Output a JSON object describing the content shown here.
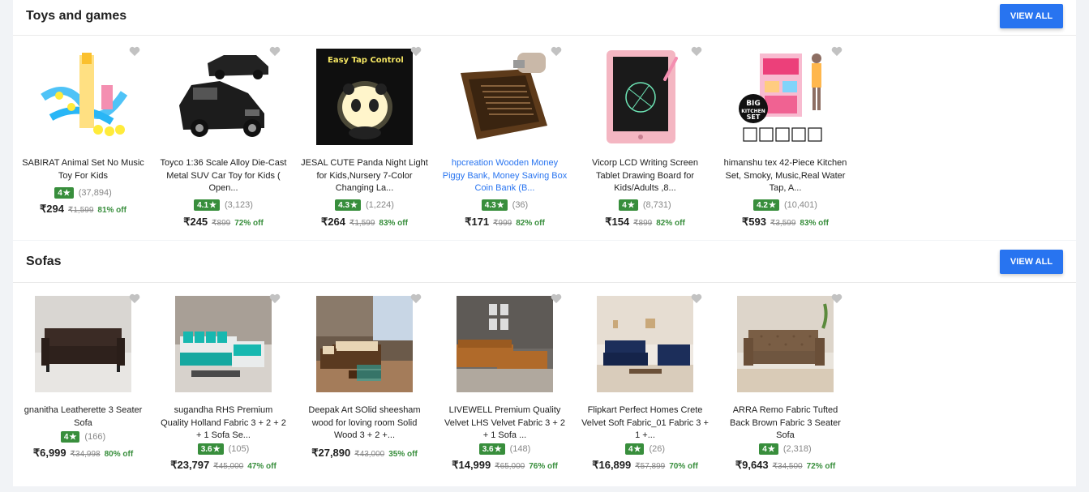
{
  "sections": [
    {
      "title": "Toys and games",
      "view_all": "VIEW ALL",
      "products": [
        {
          "title": "SABIRAT Animal Set No Music Toy For Kids",
          "rating": "4",
          "count": "(37,894)",
          "price": "₹294",
          "mrp": "₹1,599",
          "off": "81% off"
        },
        {
          "title": "Toyco 1:36 Scale Alloy Die-Cast Metal SUV Car Toy for Kids ( Open...",
          "rating": "4.1",
          "count": "(3,123)",
          "price": "₹245",
          "mrp": "₹899",
          "off": "72% off"
        },
        {
          "title": "JESAL CUTE Panda Night Light for Kids,Nursery 7-Color Changing La...",
          "rating": "4.3",
          "count": "(1,224)",
          "price": "₹264",
          "mrp": "₹1,599",
          "off": "83% off",
          "image_text": "Easy Tap Control"
        },
        {
          "title": "hpcreation Wooden Money Piggy Bank, Money Saving Box Coin Bank (B...",
          "rating": "4.3",
          "count": "(36)",
          "price": "₹171",
          "mrp": "₹999",
          "off": "82% off"
        },
        {
          "title": "Vicorp LCD Writing Screen Tablet Drawing Board for Kids/Adults ,8...",
          "rating": "4",
          "count": "(8,731)",
          "price": "₹154",
          "mrp": "₹899",
          "off": "82% off"
        },
        {
          "title": "himanshu tex 42-Piece Kitchen Set, Smoky, Music,Real Water Tap, A...",
          "rating": "4.2",
          "count": "(10,401)",
          "price": "₹593",
          "mrp": "₹3,599",
          "off": "83% off",
          "image_text_1": "BIG",
          "image_text_2": "KITCHEN",
          "image_text_3": "SET"
        }
      ]
    },
    {
      "title": "Sofas",
      "view_all": "VIEW ALL",
      "products": [
        {
          "title": "gnanitha Leatherette 3 Seater Sofa",
          "rating": "4",
          "count": "(166)",
          "price": "₹6,999",
          "mrp": "₹34,998",
          "off": "80% off"
        },
        {
          "title": "sugandha RHS Premium Quality Holland Fabric 3 + 2 + 2 + 1 Sofa Se...",
          "rating": "3.6",
          "count": "(105)",
          "price": "₹23,797",
          "mrp": "₹45,000",
          "off": "47% off"
        },
        {
          "title": "Deepak Art SOlid sheesham wood for loving room Solid Wood 3 + 2 +...",
          "rating": "",
          "count": "",
          "price": "₹27,890",
          "mrp": "₹43,000",
          "off": "35% off"
        },
        {
          "title": "LIVEWELL Premium Quality Velvet LHS Velvet Fabric 3 + 2 + 1 Sofa ...",
          "rating": "3.6",
          "count": "(148)",
          "price": "₹14,999",
          "mrp": "₹65,000",
          "off": "76% off"
        },
        {
          "title": "Flipkart Perfect Homes Crete Velvet Soft Fabric_01 Fabric 3 + 1 +...",
          "rating": "4",
          "count": "(26)",
          "price": "₹16,899",
          "mrp": "₹57,899",
          "off": "70% off"
        },
        {
          "title": "ARRA Remo Fabric Tufted Back Brown Fabric 3 Seater Sofa",
          "rating": "4",
          "count": "(2,318)",
          "price": "₹9,643",
          "mrp": "₹34,500",
          "off": "72% off"
        }
      ]
    }
  ],
  "colors": {
    "accent": "#2874f0",
    "rating_green": "#388e3c",
    "off_green": "#388e3c"
  }
}
